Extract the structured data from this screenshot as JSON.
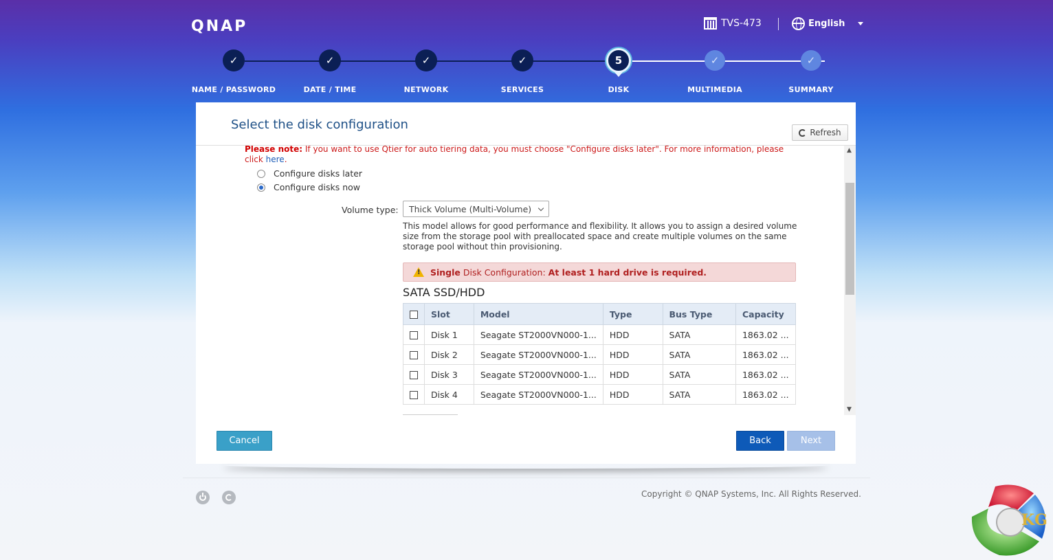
{
  "header": {
    "brand": "QNAP",
    "device_model": "TVS-473",
    "language": "English"
  },
  "steps": [
    {
      "label": "NAME / PASSWORD",
      "state": "done"
    },
    {
      "label": "DATE / TIME",
      "state": "done"
    },
    {
      "label": "NETWORK",
      "state": "done"
    },
    {
      "label": "SERVICES",
      "state": "done"
    },
    {
      "label": "DISK",
      "state": "current",
      "number": "5"
    },
    {
      "label": "MULTIMEDIA",
      "state": "pending"
    },
    {
      "label": "SUMMARY",
      "state": "pending"
    }
  ],
  "panel": {
    "title": "Select the disk configuration",
    "refresh_label": "Refresh",
    "note_label": "Please note:",
    "note_text": " If you want to use Qtier for auto tiering data, you must choose \"Configure disks later\". For more information, please click ",
    "note_link": "here",
    "note_end": ".",
    "radio_later": "Configure disks later",
    "radio_now": "Configure disks now",
    "selected_option": "Configure disks now",
    "volume_type_label": "Volume type:",
    "volume_type_value": "Thick Volume (Multi-Volume)",
    "volume_type_desc": "This model allows for good performance and flexibility. It allows you to assign a desired volume size from the storage pool with preallocated space and create multiple volumes on the same storage pool without thin provisioning.",
    "warning_prefix": "Single",
    "warning_middle": " Disk Configuration: ",
    "warning_strong": "At least 1 hard drive is required.",
    "section_title": "SATA SSD/HDD",
    "table": {
      "headers": [
        "Slot",
        "Model",
        "Type",
        "Bus Type",
        "Capacity"
      ],
      "rows": [
        {
          "slot": "Disk 1",
          "model": "Seagate ST2000VN000-1...",
          "type": "HDD",
          "bus": "SATA",
          "capacity": "1863.02 ...",
          "checked": false
        },
        {
          "slot": "Disk 2",
          "model": "Seagate ST2000VN000-1...",
          "type": "HDD",
          "bus": "SATA",
          "capacity": "1863.02 ...",
          "checked": false
        },
        {
          "slot": "Disk 3",
          "model": "Seagate ST2000VN000-1...",
          "type": "HDD",
          "bus": "SATA",
          "capacity": "1863.02 ...",
          "checked": false
        },
        {
          "slot": "Disk 4",
          "model": "Seagate ST2000VN000-1...",
          "type": "HDD",
          "bus": "SATA",
          "capacity": "1863.02 ...",
          "checked": false
        }
      ]
    },
    "buttons": {
      "cancel": "Cancel",
      "back": "Back",
      "next": "Next"
    }
  },
  "footer": {
    "copyright": "Copyright © QNAP Systems, Inc. All Rights Reserved.",
    "icons": [
      "power-icon",
      "restart-icon"
    ]
  },
  "watermark": {
    "text": "KG"
  },
  "colors": {
    "accent": "#0e5ab8",
    "cancel": "#3aa0c8",
    "next_disabled": "#a6c0e8",
    "warning_bg": "#f4d8d8",
    "note_red": "#cc1a1a"
  }
}
